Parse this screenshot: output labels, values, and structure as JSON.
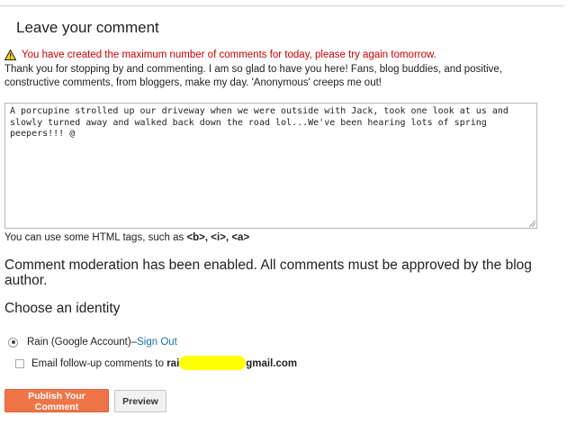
{
  "form": {
    "heading": "Leave your comment",
    "warning_text": "You have created the maximum number of comments for today, please try again tomorrow.",
    "intro_text": "Thank you for stopping by and commenting. I am so glad to have you here! Fans, blog buddies, and positive, constructive comments, from bloggers, make my day. 'Anonymous' creeps me out!",
    "comment_value": "A porcupine strolled up our driveway when we were outside with Jack, took one look at us and slowly turned away and walked back down the road lol...We've been hearing lots of spring peepers!!! @",
    "html_hint_prefix": "You can use some HTML tags, such as",
    "html_tags": [
      "<b>",
      "<i>",
      "<a>"
    ],
    "moderation_text": "Comment moderation has been enabled. All comments must be approved by the blog author.",
    "identity_heading": "Choose an identity",
    "identity_account": "Rain (Google Account)",
    "identity_separator": " – ",
    "sign_out_label": "Sign Out",
    "followup_label": "Email follow-up comments to",
    "email_prefix": "rai",
    "email_suffix": "gmail.com",
    "publish_label": "Publish Your Comment",
    "preview_label": "Preview"
  },
  "colors": {
    "warning": "#cc0000",
    "publish_button": "#ef7549",
    "link": "#1a6fa8",
    "redaction": "#ffff00"
  },
  "icons": {
    "warning": "warning-triangle-icon",
    "resize": "resize-grip-icon"
  }
}
